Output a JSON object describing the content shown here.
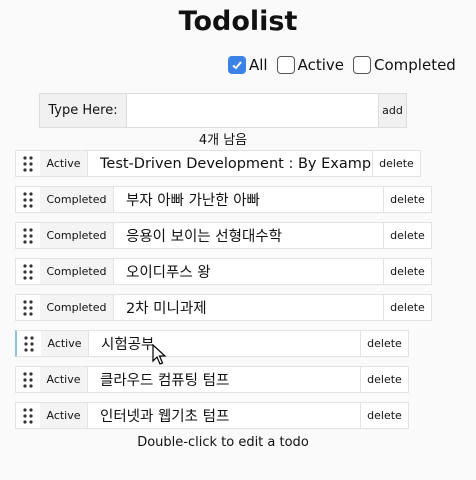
{
  "title": "Todolist",
  "filters": [
    {
      "label": "All",
      "checked": true
    },
    {
      "label": "Active",
      "checked": false
    },
    {
      "label": "Completed",
      "checked": false
    }
  ],
  "input": {
    "label": "Type Here:",
    "value": "",
    "add_label": "add"
  },
  "remaining": "4개 남음",
  "todos": [
    {
      "status": "Active",
      "text": "Test-Driven Development : By Example",
      "delete_label": "delete"
    },
    {
      "status": "Completed",
      "text": "부자 아빠 가난한 아빠",
      "delete_label": "delete"
    },
    {
      "status": "Completed",
      "text": "응용이 보이는 선형대수학",
      "delete_label": "delete"
    },
    {
      "status": "Completed",
      "text": "오이디푸스 왕",
      "delete_label": "delete"
    },
    {
      "status": "Completed",
      "text": "2차 미니과제",
      "delete_label": "delete"
    },
    {
      "status": "Active",
      "text": "시험공부",
      "delete_label": "delete"
    },
    {
      "status": "Active",
      "text": "클라우드 컴퓨팅 텀프",
      "delete_label": "delete"
    },
    {
      "status": "Active",
      "text": "인터넷과 웹기초 텀프",
      "delete_label": "delete"
    }
  ],
  "hint": "Double-click to edit a todo",
  "colors": {
    "accent": "#3b82e6",
    "selected_border": "#8fc3e0"
  }
}
